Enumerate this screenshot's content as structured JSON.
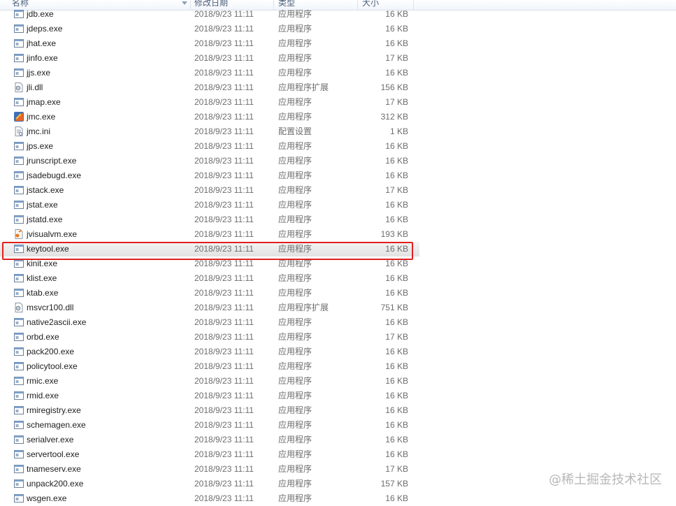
{
  "columns": {
    "name": "名称",
    "date": "修改日期",
    "type": "类型",
    "size": "大小"
  },
  "files": [
    {
      "name": "jdb.exe",
      "date": "2018/9/23 11:11",
      "type": "应用程序",
      "size": "16 KB",
      "icon": "exe"
    },
    {
      "name": "jdeps.exe",
      "date": "2018/9/23 11:11",
      "type": "应用程序",
      "size": "16 KB",
      "icon": "exe"
    },
    {
      "name": "jhat.exe",
      "date": "2018/9/23 11:11",
      "type": "应用程序",
      "size": "16 KB",
      "icon": "exe"
    },
    {
      "name": "jinfo.exe",
      "date": "2018/9/23 11:11",
      "type": "应用程序",
      "size": "17 KB",
      "icon": "exe"
    },
    {
      "name": "jjs.exe",
      "date": "2018/9/23 11:11",
      "type": "应用程序",
      "size": "16 KB",
      "icon": "exe"
    },
    {
      "name": "jli.dll",
      "date": "2018/9/23 11:11",
      "type": "应用程序扩展",
      "size": "156 KB",
      "icon": "dll"
    },
    {
      "name": "jmap.exe",
      "date": "2018/9/23 11:11",
      "type": "应用程序",
      "size": "17 KB",
      "icon": "exe"
    },
    {
      "name": "jmc.exe",
      "date": "2018/9/23 11:11",
      "type": "应用程序",
      "size": "312 KB",
      "icon": "jmc"
    },
    {
      "name": "jmc.ini",
      "date": "2018/9/23 11:11",
      "type": "配置设置",
      "size": "1 KB",
      "icon": "ini"
    },
    {
      "name": "jps.exe",
      "date": "2018/9/23 11:11",
      "type": "应用程序",
      "size": "16 KB",
      "icon": "exe"
    },
    {
      "name": "jrunscript.exe",
      "date": "2018/9/23 11:11",
      "type": "应用程序",
      "size": "16 KB",
      "icon": "exe"
    },
    {
      "name": "jsadebugd.exe",
      "date": "2018/9/23 11:11",
      "type": "应用程序",
      "size": "16 KB",
      "icon": "exe"
    },
    {
      "name": "jstack.exe",
      "date": "2018/9/23 11:11",
      "type": "应用程序",
      "size": "17 KB",
      "icon": "exe"
    },
    {
      "name": "jstat.exe",
      "date": "2018/9/23 11:11",
      "type": "应用程序",
      "size": "16 KB",
      "icon": "exe"
    },
    {
      "name": "jstatd.exe",
      "date": "2018/9/23 11:11",
      "type": "应用程序",
      "size": "16 KB",
      "icon": "exe"
    },
    {
      "name": "jvisualvm.exe",
      "date": "2018/9/23 11:11",
      "type": "应用程序",
      "size": "193 KB",
      "icon": "jvisualvm"
    },
    {
      "name": "keytool.exe",
      "date": "2018/9/23 11:11",
      "type": "应用程序",
      "size": "16 KB",
      "icon": "exe",
      "highlighted": true
    },
    {
      "name": "kinit.exe",
      "date": "2018/9/23 11:11",
      "type": "应用程序",
      "size": "16 KB",
      "icon": "exe"
    },
    {
      "name": "klist.exe",
      "date": "2018/9/23 11:11",
      "type": "应用程序",
      "size": "16 KB",
      "icon": "exe"
    },
    {
      "name": "ktab.exe",
      "date": "2018/9/23 11:11",
      "type": "应用程序",
      "size": "16 KB",
      "icon": "exe"
    },
    {
      "name": "msvcr100.dll",
      "date": "2018/9/23 11:11",
      "type": "应用程序扩展",
      "size": "751 KB",
      "icon": "dll"
    },
    {
      "name": "native2ascii.exe",
      "date": "2018/9/23 11:11",
      "type": "应用程序",
      "size": "16 KB",
      "icon": "exe"
    },
    {
      "name": "orbd.exe",
      "date": "2018/9/23 11:11",
      "type": "应用程序",
      "size": "17 KB",
      "icon": "exe"
    },
    {
      "name": "pack200.exe",
      "date": "2018/9/23 11:11",
      "type": "应用程序",
      "size": "16 KB",
      "icon": "exe"
    },
    {
      "name": "policytool.exe",
      "date": "2018/9/23 11:11",
      "type": "应用程序",
      "size": "16 KB",
      "icon": "exe"
    },
    {
      "name": "rmic.exe",
      "date": "2018/9/23 11:11",
      "type": "应用程序",
      "size": "16 KB",
      "icon": "exe"
    },
    {
      "name": "rmid.exe",
      "date": "2018/9/23 11:11",
      "type": "应用程序",
      "size": "16 KB",
      "icon": "exe"
    },
    {
      "name": "rmiregistry.exe",
      "date": "2018/9/23 11:11",
      "type": "应用程序",
      "size": "16 KB",
      "icon": "exe"
    },
    {
      "name": "schemagen.exe",
      "date": "2018/9/23 11:11",
      "type": "应用程序",
      "size": "16 KB",
      "icon": "exe"
    },
    {
      "name": "serialver.exe",
      "date": "2018/9/23 11:11",
      "type": "应用程序",
      "size": "16 KB",
      "icon": "exe"
    },
    {
      "name": "servertool.exe",
      "date": "2018/9/23 11:11",
      "type": "应用程序",
      "size": "16 KB",
      "icon": "exe"
    },
    {
      "name": "tnameserv.exe",
      "date": "2018/9/23 11:11",
      "type": "应用程序",
      "size": "17 KB",
      "icon": "exe"
    },
    {
      "name": "unpack200.exe",
      "date": "2018/9/23 11:11",
      "type": "应用程序",
      "size": "157 KB",
      "icon": "exe"
    },
    {
      "name": "wsgen.exe",
      "date": "2018/9/23 11:11",
      "type": "应用程序",
      "size": "16 KB",
      "icon": "exe"
    }
  ],
  "watermark": "@稀土掘金技术社区",
  "colors": {
    "highlight_border": "#e02020",
    "header_text": "#4c607a",
    "secondary_text": "#6d6d6d"
  }
}
